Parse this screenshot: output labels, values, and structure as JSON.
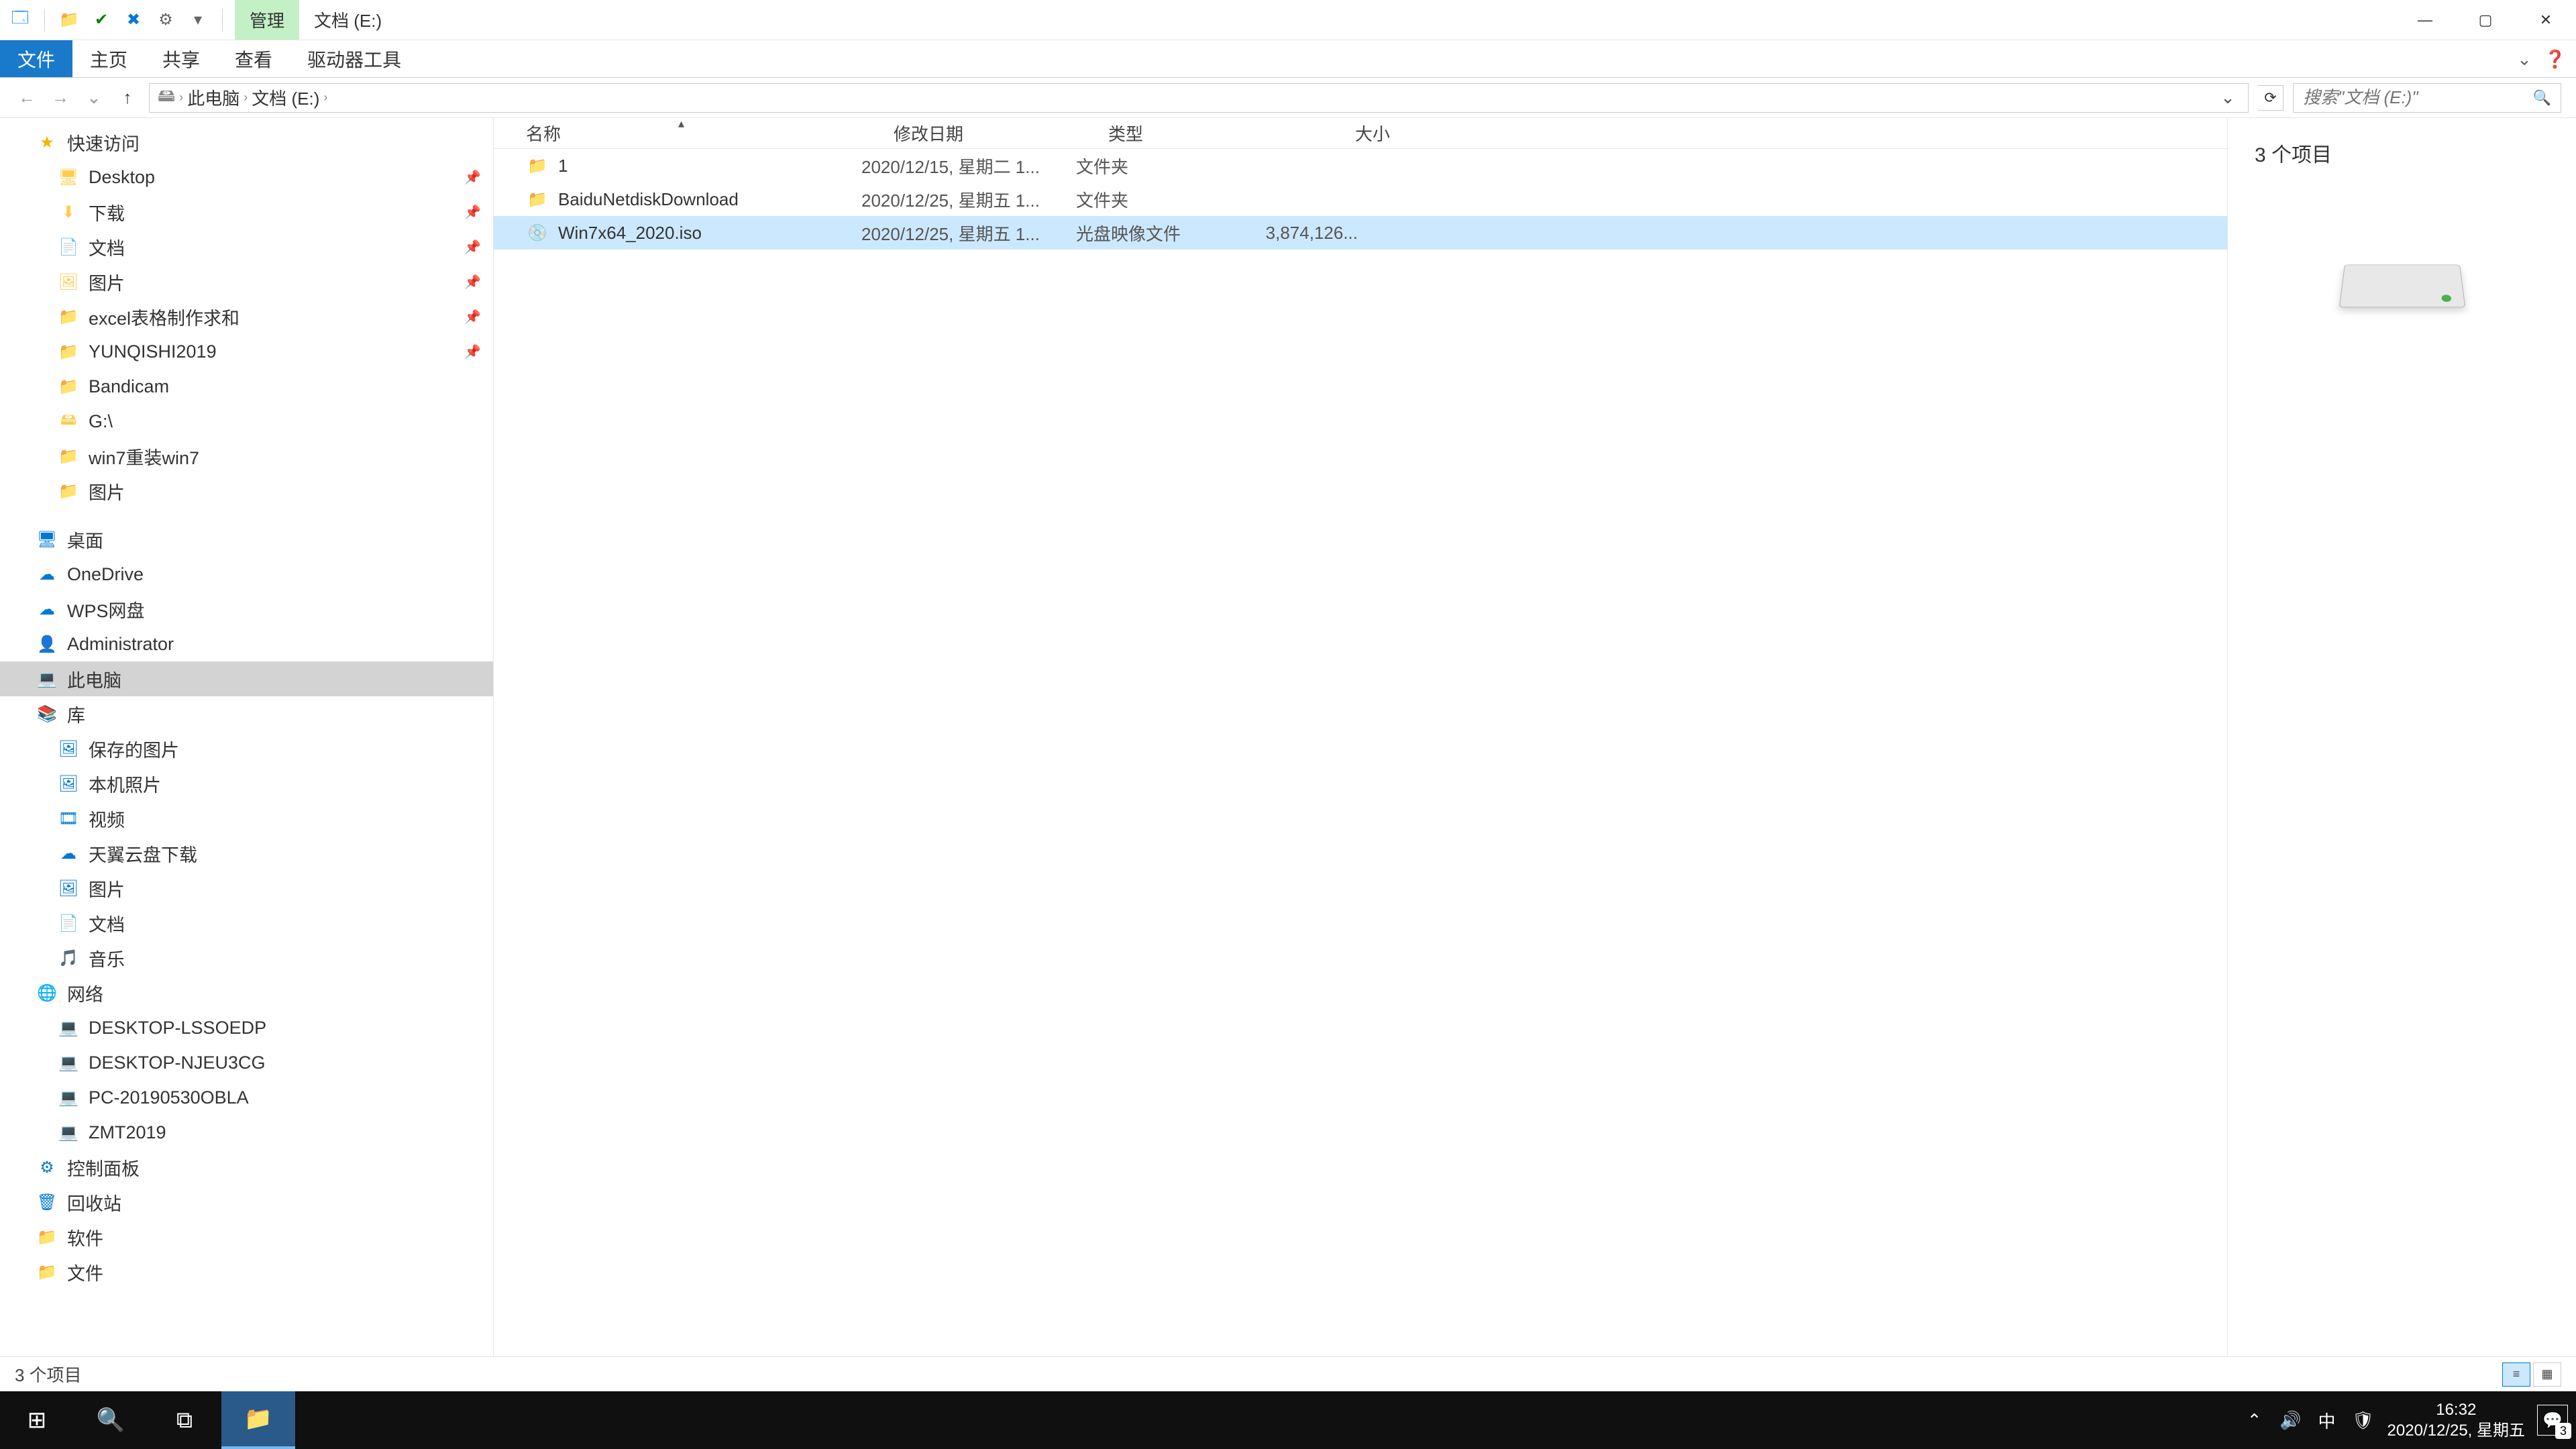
{
  "title_tabs": {
    "context": "管理",
    "location": "文档 (E:)"
  },
  "ribbon": {
    "file": "文件",
    "home": "主页",
    "share": "共享",
    "view": "查看",
    "drivetools": "驱动器工具"
  },
  "breadcrumb": {
    "root": "此电脑",
    "current": "文档 (E:)"
  },
  "search": {
    "placeholder": "搜索\"文档 (E:)\""
  },
  "columns": {
    "name": "名称",
    "date": "修改日期",
    "type": "类型",
    "size": "大小"
  },
  "rows": [
    {
      "name": "1",
      "date": "2020/12/15, 星期二 1...",
      "type": "文件夹",
      "size": "",
      "icon": "folder",
      "selected": false
    },
    {
      "name": "BaiduNetdiskDownload",
      "date": "2020/12/25, 星期五 1...",
      "type": "文件夹",
      "size": "",
      "icon": "folder",
      "selected": false
    },
    {
      "name": "Win7x64_2020.iso",
      "date": "2020/12/25, 星期五 1...",
      "type": "光盘映像文件",
      "size": "3,874,126...",
      "icon": "iso",
      "selected": true
    }
  ],
  "sidebar": {
    "quick_access": "快速访问",
    "quick_items": [
      {
        "label": "Desktop",
        "icon": "desktop"
      },
      {
        "label": "下载",
        "icon": "download"
      },
      {
        "label": "文档",
        "icon": "doc"
      },
      {
        "label": "图片",
        "icon": "pic"
      },
      {
        "label": "excel表格制作求和",
        "icon": "folder"
      },
      {
        "label": "YUNQISHI2019",
        "icon": "folder"
      },
      {
        "label": "Bandicam",
        "icon": "folder"
      },
      {
        "label": "G:\\",
        "icon": "drive"
      },
      {
        "label": "win7重装win7",
        "icon": "folder"
      },
      {
        "label": "图片",
        "icon": "folder"
      }
    ],
    "desktop": "桌面",
    "desktop_items": [
      {
        "label": "OneDrive",
        "icon": "cloud"
      },
      {
        "label": "WPS网盘",
        "icon": "cloud"
      },
      {
        "label": "Administrator",
        "icon": "user"
      },
      {
        "label": "此电脑",
        "icon": "pc",
        "selected": true
      },
      {
        "label": "库",
        "icon": "lib"
      },
      {
        "label": "保存的图片",
        "icon": "pic",
        "indent": true
      },
      {
        "label": "本机照片",
        "icon": "pic",
        "indent": true
      },
      {
        "label": "视频",
        "icon": "video",
        "indent": true
      },
      {
        "label": "天翼云盘下载",
        "icon": "cloud",
        "indent": true
      },
      {
        "label": "图片",
        "icon": "pic",
        "indent": true
      },
      {
        "label": "文档",
        "icon": "doc",
        "indent": true
      },
      {
        "label": "音乐",
        "icon": "music",
        "indent": true
      },
      {
        "label": "网络",
        "icon": "net"
      },
      {
        "label": "DESKTOP-LSSOEDP",
        "icon": "pc",
        "indent": true
      },
      {
        "label": "DESKTOP-NJEU3CG",
        "icon": "pc",
        "indent": true
      },
      {
        "label": "PC-20190530OBLA",
        "icon": "pc",
        "indent": true
      },
      {
        "label": "ZMT2019",
        "icon": "pc",
        "indent": true
      },
      {
        "label": "控制面板",
        "icon": "cpanel"
      },
      {
        "label": "回收站",
        "icon": "trash"
      },
      {
        "label": "软件",
        "icon": "folder"
      },
      {
        "label": "文件",
        "icon": "folder"
      }
    ]
  },
  "preview": {
    "count": "3 个项目"
  },
  "status": {
    "text": "3 个项目"
  },
  "taskbar": {
    "time": "16:32",
    "date": "2020/12/25, 星期五",
    "ime": "中",
    "notif_count": "3"
  }
}
